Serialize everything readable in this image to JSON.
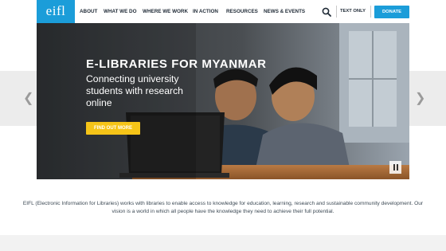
{
  "logo": "eifl",
  "nav": {
    "items": [
      {
        "label": "ABOUT"
      },
      {
        "label": "WHAT WE DO"
      },
      {
        "label": "WHERE WE WORK"
      },
      {
        "label": "IN ACTION"
      },
      {
        "label": "RESOURCES"
      },
      {
        "label": "NEWS & EVENTS"
      }
    ],
    "text_only": "TEXT ONLY",
    "donate": "DONATE",
    "search_icon": "search-icon"
  },
  "hero": {
    "title": "E-LIBRARIES FOR MYANMAR",
    "subtitle": "Connecting university students with research online",
    "cta": "FIND OUT MORE"
  },
  "mission": "EIFL (Electronic Information for Libraries) works with libraries to enable access to knowledge for education, learning, research and sustainable community development. Our vision is a world in which all people have the knowledge they need to achieve their full potential.",
  "colors": {
    "brand": "#1b9dd9",
    "cta": "#f5c418",
    "nav_text": "#1f2a36"
  }
}
